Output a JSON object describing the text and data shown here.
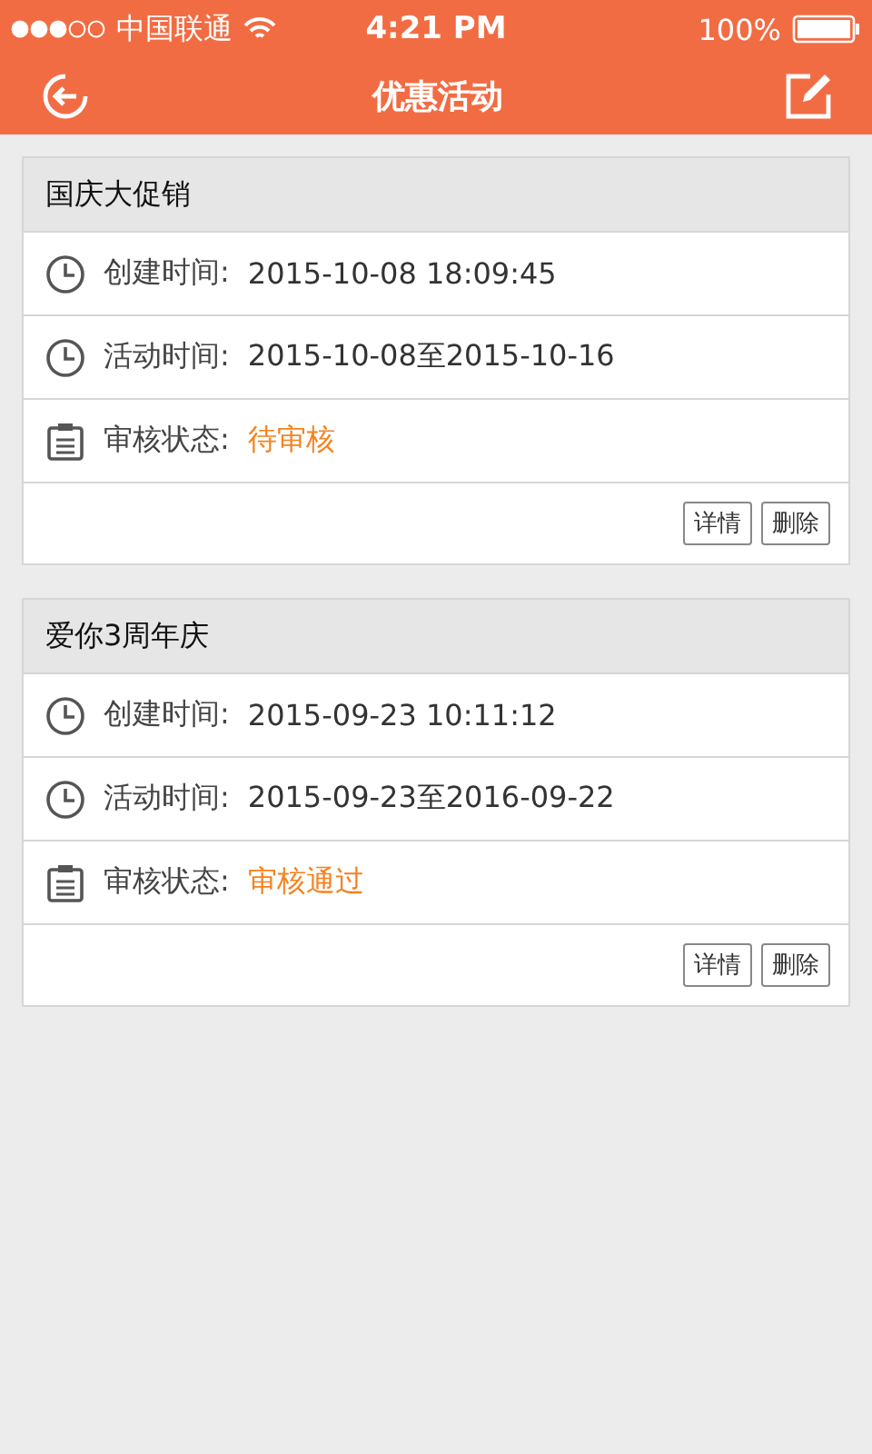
{
  "status_bar": {
    "carrier": "中国联通",
    "time": "4:21 PM",
    "battery": "100%"
  },
  "nav_bar": {
    "title": "优惠活动"
  },
  "activities": [
    {
      "title": "国庆大促销",
      "rows": [
        {
          "kind": "time",
          "label": "创建时间:",
          "value": "2015-10-08 18:09:45"
        },
        {
          "kind": "time",
          "label": "活动时间:",
          "value": "2015-10-08至2015-10-16"
        },
        {
          "kind": "status",
          "label": "审核状态:",
          "value": "待审核"
        }
      ],
      "buttons": [
        "详情",
        "删除"
      ]
    },
    {
      "title": "爱你3周年庆",
      "rows": [
        {
          "kind": "time",
          "label": "创建时间:",
          "value": "2015-09-23 10:11:12"
        },
        {
          "kind": "time",
          "label": "活动时间:",
          "value": "2015-09-23至2016-09-22"
        },
        {
          "kind": "status",
          "label": "审核状态:",
          "value": "审核通过"
        }
      ],
      "buttons": [
        "详情",
        "删除"
      ]
    }
  ]
}
